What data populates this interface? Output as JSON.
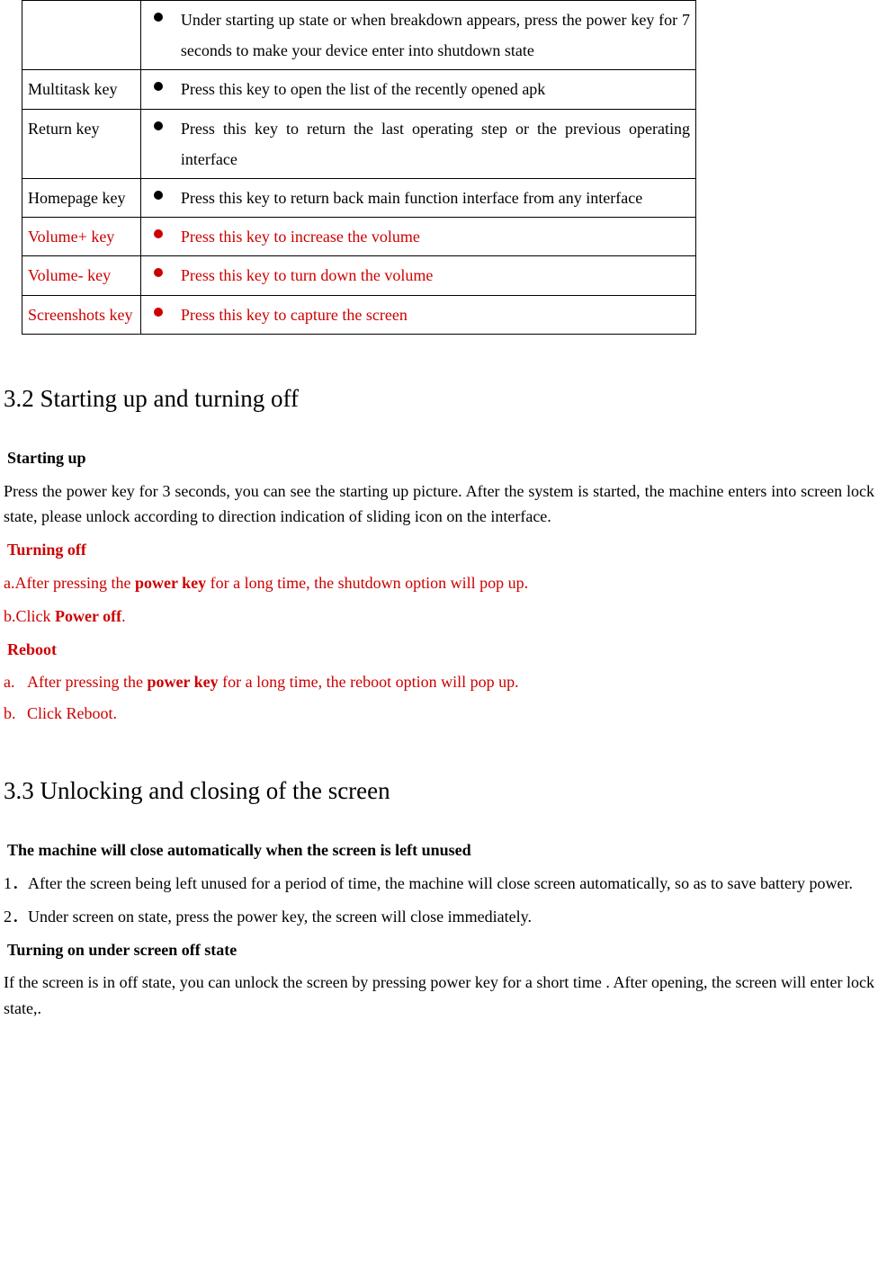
{
  "table": {
    "rows": [
      {
        "key": "",
        "desc": "Under starting up state or when breakdown appears, press the power key for 7 seconds to make your device enter into shutdown state",
        "red": false
      },
      {
        "key": "Multitask key",
        "desc": "Press this key to open the list of the recently opened apk",
        "red": false
      },
      {
        "key": "Return key",
        "desc": "Press this key to return the last operating step or the previous operating interface",
        "red": false
      },
      {
        "key": "Homepage key",
        "desc": "Press this key to return back main function interface from any interface",
        "red": false
      },
      {
        "key": "Volume+ key",
        "desc": "Press this key to increase the volume",
        "red": true
      },
      {
        "key": "Volume- key",
        "desc": "Press this key to turn down the volume",
        "red": true
      },
      {
        "key": "Screenshots key",
        "desc": "Press this key to capture the screen",
        "red": true
      }
    ]
  },
  "sec32": {
    "heading": "3.2 Starting up and turning off",
    "starting_label": "Starting up",
    "starting_text": "Press the power key for 3 seconds, you can see the starting up picture. After the system is started, the machine enters into screen lock state, please unlock according to direction indication of sliding icon on the interface.",
    "turning_off_label": "Turning off",
    "turning_off_a_prefix": "a.After pressing the ",
    "turning_off_a_bold": "power key",
    "turning_off_a_suffix": " for a long time, the shutdown option will pop up.",
    "turning_off_b_prefix": "b.Click ",
    "turning_off_b_bold": "Power off",
    "turning_off_b_suffix": ".",
    "reboot_label": "Reboot",
    "reboot_a_label": "a.",
    "reboot_a_prefix": "After pressing the ",
    "reboot_a_bold": "power key",
    "reboot_a_suffix": " for a long time, the reboot option will pop up.",
    "reboot_b_label": "b.",
    "reboot_b_text": "Click Reboot."
  },
  "sec33": {
    "heading": "3.3 Unlocking and closing of the screen",
    "auto_label": "The machine will close automatically when the screen is left unused",
    "auto_1": "1．After the screen being left unused for a period of time, the machine will close screen automatically, so as to save battery power.",
    "auto_2": "2．Under screen on state, press the power key, the screen will close immediately.",
    "turn_on_label": "Turning on under screen off state",
    "turn_on_text": "If the screen is in off state, you can unlock the screen by pressing power key for a short time . After opening, the screen will enter lock state,."
  }
}
